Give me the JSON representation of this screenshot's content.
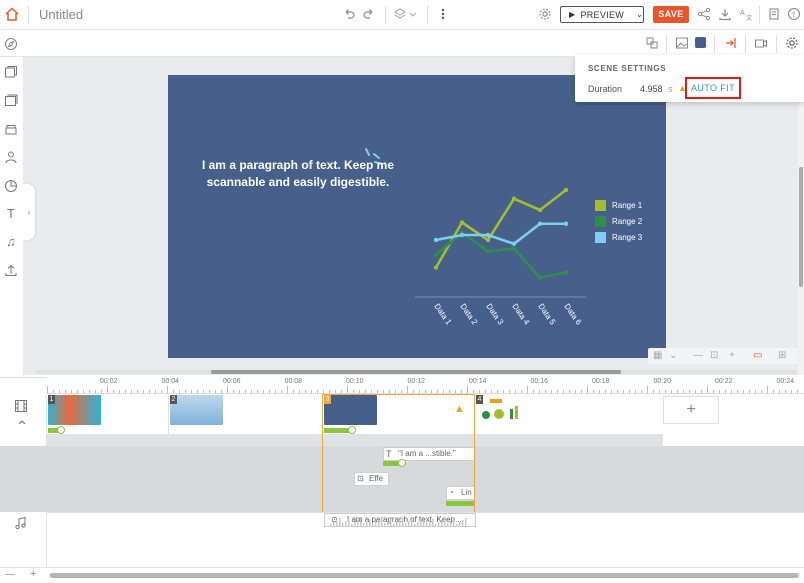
{
  "header": {
    "title": "Untitled",
    "preview_label": "PREVIEW",
    "save_label": "SAVE"
  },
  "scene": {
    "paragraph": "I am a paragraph of text. Keep me scannable and easily digestible.",
    "background_color": "#46608b"
  },
  "chart_data": {
    "type": "line",
    "categories": [
      "Data 1",
      "Data 2",
      "Data 3",
      "Data 4",
      "Data 5",
      "Data 6"
    ],
    "series": [
      {
        "name": "Range 1",
        "color": "#a3be2a",
        "values": [
          1.0,
          4.6,
          3.2,
          6.5,
          5.6,
          7.2
        ]
      },
      {
        "name": "Range 2",
        "color": "#2f8f4a",
        "values": [
          2.0,
          3.8,
          2.3,
          2.5,
          0.2,
          0.6
        ]
      },
      {
        "name": "Range 3",
        "color": "#7ccef3",
        "values": [
          3.2,
          3.6,
          3.6,
          2.9,
          4.5,
          4.5
        ]
      }
    ],
    "ylim": [
      0,
      8
    ],
    "grid": false,
    "legend": "right"
  },
  "scene_settings": {
    "title": "SCENE SETTINGS",
    "duration_label": "Duration",
    "duration_value": "4.958",
    "duration_unit": "s",
    "auto_fit_label": "AUTO FIT"
  },
  "timeline": {
    "ruler_labels": [
      "00:02",
      "00:04",
      "00:06",
      "00:08",
      "00:10",
      "00:12",
      "00:14",
      "00:16",
      "00:18",
      "00:20",
      "00:22",
      "00:24"
    ],
    "scenes": [
      {
        "number": "1",
        "thumb_color": "#2bb3d6"
      },
      {
        "number": "2",
        "thumb_color": "#7fb2d8"
      },
      {
        "number": "3",
        "thumb_color": "#46608b"
      },
      {
        "number": "4",
        "thumb_color": "#ffffff"
      }
    ],
    "elements": {
      "text_clip": "\"I am a ...stible.\"",
      "effect_clip": "Effe",
      "line_clip": "Lin"
    },
    "audio_clip": "I am a paragraph of text. Keep..."
  },
  "colors": {
    "accent": "#e8562a",
    "highlight": "#e21a1a",
    "link": "#2e95c7",
    "track_green": "#8cc63f",
    "selected_border": "#f2a642"
  }
}
